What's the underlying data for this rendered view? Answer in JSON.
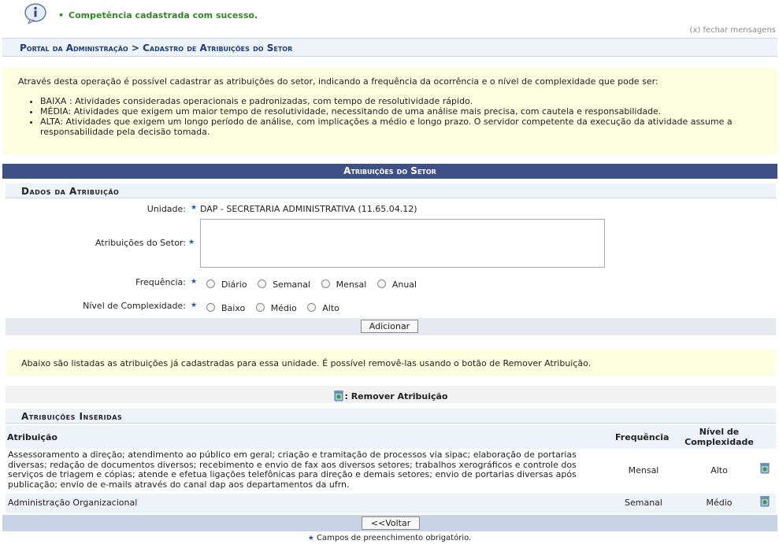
{
  "message": {
    "text": "Competência cadastrada com sucesso.",
    "close_label": "(x) fechar mensagens"
  },
  "breadcrumb": "Portal da Administração > Cadastro de Atribuições do Setor",
  "description": {
    "intro": "Através desta operação é possível cadastrar as atribuições do setor, indicando a frequência da ocorrência e o nível de complexidade que pode ser:",
    "items": [
      "BAIXA : Atividades consideradas operacionais e padronizadas, com tempo de resolutividade rápido.",
      "MÉDIA: Atividades que exigem um maior tempo de resolutividade, necessitando de uma análise mais precisa, com cautela e responsabilidade.",
      "ALTA: Atividades que exigem um longo período de análise, com implicações a médio e longo prazo. O servidor competente da execução da atividade assume a responsabilidade pela decisão tomada."
    ]
  },
  "form": {
    "title": "Atribuições do Setor",
    "section_title": "Dados da Atribuição",
    "unidade_label": "Unidade:",
    "unidade_value": "DAP - SECRETARIA ADMINISTRATIVA (11.65.04.12)",
    "atribuicoes_label": "Atribuições do Setor:",
    "atribuicoes_value": "",
    "frequencia_label": "Frequência:",
    "frequencia_options": [
      "Diário",
      "Semanal",
      "Mensal",
      "Anual"
    ],
    "complexidade_label": "Nível de Complexidade:",
    "complexidade_options": [
      "Baixo",
      "Médio",
      "Alto"
    ],
    "add_button": "Adicionar"
  },
  "note": "Abaixo são listadas as atribuições já cadastradas para essa unidade. É possível removê-las usando o botão de Remover Atribuição.",
  "legend": ": Remover Atribuição",
  "table": {
    "title": "Atribuições Inseridas",
    "headers": [
      "Atribuição",
      "Frequência",
      "Nível de Complexidade"
    ],
    "rows": [
      {
        "atribuicao": "Assessoramento a direção; atendimento ao público em geral; criação e tramitação de processos via sipac; elaboração de portarias diversas; redação de documentos diversos; recebimento e envio de fax aos diversos setores; trabalhos xerográficos e controle dos serviços de triagem e cópias; atende e efetua ligações telefônicas para direção e demais setores; envio de portarias diversas após publicação; envio de e-mails através do canal dap aos departamentos da ufrn.",
        "frequencia": "Mensal",
        "nivel": "Alto"
      },
      {
        "atribuicao": "Administração Organizacional",
        "frequencia": "Semanal",
        "nivel": "Médio"
      }
    ]
  },
  "back_button": "<<Voltar",
  "footer_note": "Campos de preenchimento obrigatório.",
  "colors": {
    "header_bg": "#3f5086",
    "success": "#2d8a1e",
    "note_bg": "#fdfde0",
    "title": "#1a3d79"
  }
}
